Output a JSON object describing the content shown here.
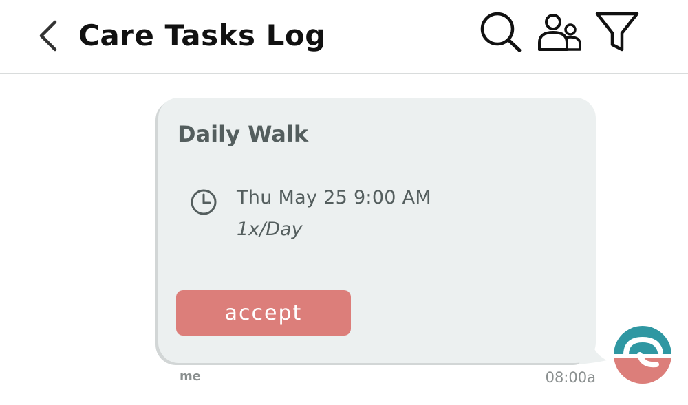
{
  "header": {
    "back_icon": "chevron-left-icon",
    "title": "Care Tasks Log",
    "actions": [
      {
        "name": "search",
        "icon": "search-icon"
      },
      {
        "name": "people",
        "icon": "people-icon"
      },
      {
        "name": "filter",
        "icon": "filter-icon"
      }
    ]
  },
  "message": {
    "card": {
      "title": "Daily Walk",
      "icon": "clock-icon",
      "datetime": "Thu May 25 9:00 AM",
      "frequency": "1x/Day",
      "accept_label": "accept"
    },
    "sender": "me",
    "time": "08:00a",
    "avatar_icon": "app-logo-avatar"
  },
  "colors": {
    "bubble_background": "#ecf0f0",
    "accept_button": "#dc7e7a",
    "avatar_teal": "#2f97a2",
    "avatar_coral": "#dc7e7a",
    "text_dark": "#545e5e",
    "text_muted": "#8a8f8f"
  }
}
